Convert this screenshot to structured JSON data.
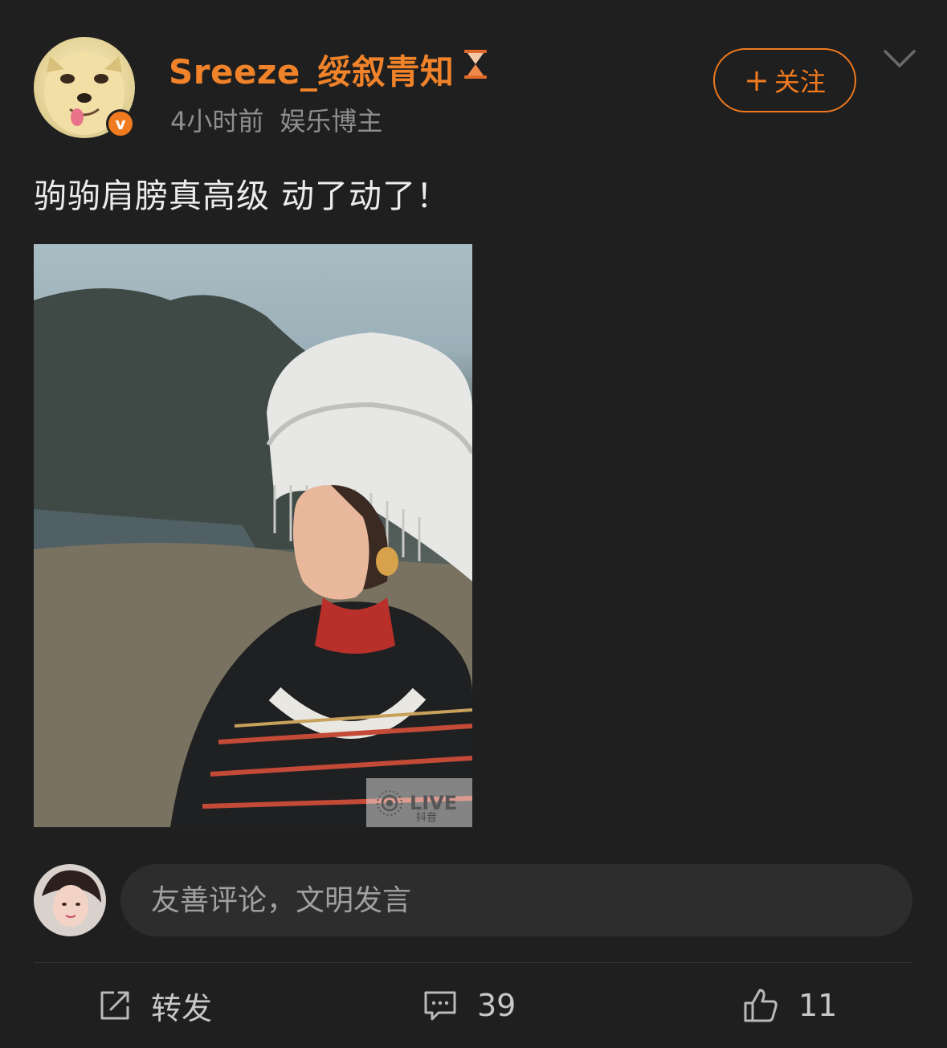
{
  "post": {
    "author": {
      "name": "Sreeze_绥叙青知",
      "verified_badge": "v",
      "avatar_icon": "doge-avatar"
    },
    "time": "4小时前",
    "category": "娱乐博主",
    "follow_label": "关注",
    "text": "驹驹肩膀真高级 动了动了！",
    "media": {
      "live_label": "LIVE",
      "watermark": "抖音"
    }
  },
  "comment": {
    "placeholder": "友善评论，文明发言"
  },
  "actions": {
    "repost_label": "转发",
    "comment_count": "39",
    "like_count": "11"
  },
  "colors": {
    "background": "#1f1f1f",
    "accent": "#f07a1f",
    "username": "#f0832a",
    "muted": "#8e8e8e"
  }
}
